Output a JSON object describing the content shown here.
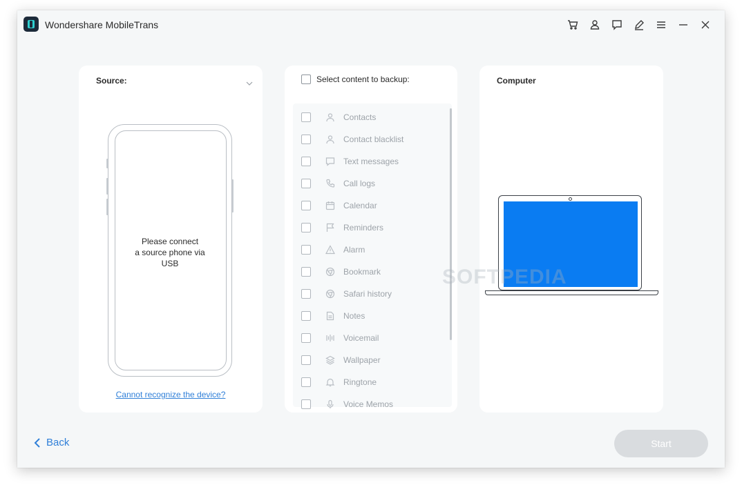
{
  "window": {
    "title": "Wondershare MobileTrans"
  },
  "titlebar_icons": [
    "cart-icon",
    "user-icon",
    "feedback-icon",
    "edit-icon",
    "menu-icon",
    "minimize-icon",
    "close-icon"
  ],
  "source": {
    "heading": "Source:",
    "message_lines": [
      "Please connect",
      "a source phone via",
      "USB"
    ],
    "link": "Cannot recognize the device?"
  },
  "content": {
    "heading": "Select content to backup:",
    "items": [
      {
        "label": "Contacts",
        "icon": "person-icon",
        "checked": false
      },
      {
        "label": "Contact blacklist",
        "icon": "person-icon",
        "checked": false
      },
      {
        "label": "Text messages",
        "icon": "message-icon",
        "checked": false
      },
      {
        "label": "Call logs",
        "icon": "phone-icon",
        "checked": false
      },
      {
        "label": "Calendar",
        "icon": "calendar-icon",
        "checked": false
      },
      {
        "label": "Reminders",
        "icon": "flag-icon",
        "checked": false
      },
      {
        "label": "Alarm",
        "icon": "warning-icon",
        "checked": false
      },
      {
        "label": "Bookmark",
        "icon": "chrome-icon",
        "checked": false
      },
      {
        "label": "Safari history",
        "icon": "chrome-icon",
        "checked": false
      },
      {
        "label": "Notes",
        "icon": "note-icon",
        "checked": false
      },
      {
        "label": "Voicemail",
        "icon": "voicemail-icon",
        "checked": false
      },
      {
        "label": "Wallpaper",
        "icon": "layers-icon",
        "checked": false
      },
      {
        "label": "Ringtone",
        "icon": "bell-icon",
        "checked": false
      },
      {
        "label": "Voice Memos",
        "icon": "mic-icon",
        "checked": false
      }
    ]
  },
  "destination": {
    "heading": "Computer"
  },
  "watermark": "SOFTPEDIA",
  "footer": {
    "back_label": "Back",
    "start_label": "Start"
  },
  "colors": {
    "accent": "#2f7fd8",
    "screen": "#0a7cf2",
    "disabled_button": "#d9dcdf"
  }
}
